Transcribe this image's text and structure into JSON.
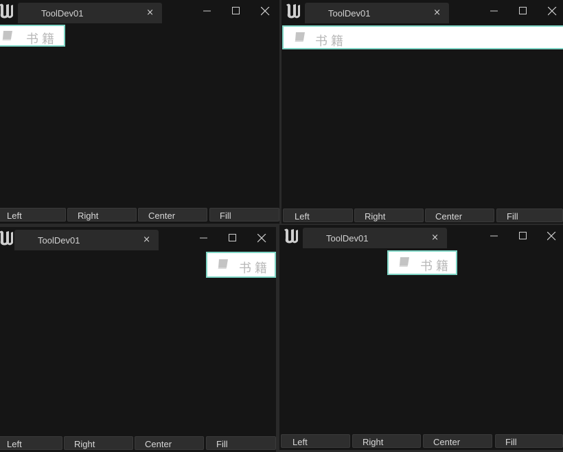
{
  "windows": [
    {
      "tab_label": "ToolDev01",
      "tab_close": "×",
      "book_label": "书籍",
      "alignment": "left",
      "buttons": [
        "Left",
        "Right",
        "Center",
        "Fill"
      ]
    },
    {
      "tab_label": "ToolDev01",
      "tab_close": "×",
      "book_label": "书籍",
      "alignment": "fill",
      "buttons": [
        "Left",
        "Right",
        "Center",
        "Fill"
      ]
    },
    {
      "tab_label": "ToolDev01",
      "tab_close": "×",
      "book_label": "书籍",
      "alignment": "right",
      "buttons": [
        "Left",
        "Right",
        "Center",
        "Fill"
      ]
    },
    {
      "tab_label": "ToolDev01",
      "tab_close": "×",
      "book_label": "书籍",
      "alignment": "center",
      "buttons": [
        "Left",
        "Right",
        "Center",
        "Fill"
      ]
    }
  ],
  "colors": {
    "window_bg": "#151515",
    "tab_bg": "#2b2b2b",
    "button_bg": "#2e2e2e",
    "book_border": "#7fd6c6",
    "book_bg": "#ffffff"
  },
  "icons": {
    "logo": "unreal-logo-icon",
    "book": "book-icon",
    "minimize": "minimize-icon",
    "maximize": "maximize-icon",
    "close": "close-icon"
  }
}
